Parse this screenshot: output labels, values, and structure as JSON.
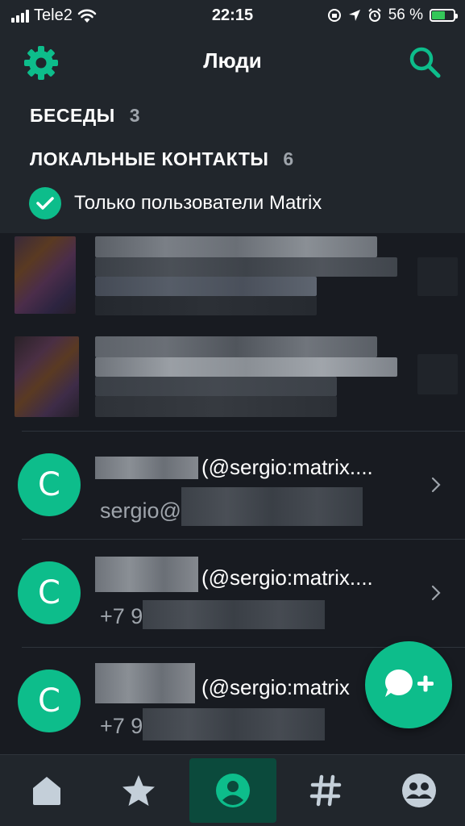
{
  "status_bar": {
    "carrier": "Tele2",
    "time": "22:15",
    "battery_percent": "56 %",
    "battery_level": 0.56
  },
  "toolbar": {
    "title": "Люди",
    "settings_icon": "gear-icon",
    "search_icon": "search-icon"
  },
  "filters": {
    "conversations_label": "БЕСЕДЫ",
    "conversations_count": "3",
    "local_contacts_label": "ЛОКАЛЬНЫЕ КОНТАКТЫ",
    "local_contacts_count": "6",
    "matrix_only_label": "Только пользователи Matrix",
    "matrix_only_checked": true
  },
  "contacts": [
    {
      "avatar_letter": "C",
      "name_suffix": "(@sergio:matrix....",
      "detail_prefix": "sergio@"
    },
    {
      "avatar_letter": "C",
      "name_suffix": "(@sergio:matrix....",
      "detail_prefix": "+7 9"
    },
    {
      "avatar_letter": "C",
      "name_suffix": "(@sergio:matrix",
      "detail_prefix": "+7 9"
    }
  ],
  "fab_icon": "new-chat-icon",
  "tabs": [
    {
      "name": "home",
      "icon": "home-icon",
      "active": false
    },
    {
      "name": "favourites",
      "icon": "star-icon",
      "active": false
    },
    {
      "name": "people",
      "icon": "person-icon",
      "active": true
    },
    {
      "name": "rooms",
      "icon": "hash-icon",
      "active": false
    },
    {
      "name": "groups",
      "icon": "groups-icon",
      "active": false
    }
  ],
  "colors": {
    "accent": "#0dbd8b",
    "background": "#181b21",
    "header": "#21262c",
    "secondary_text": "#9ea4ab"
  }
}
